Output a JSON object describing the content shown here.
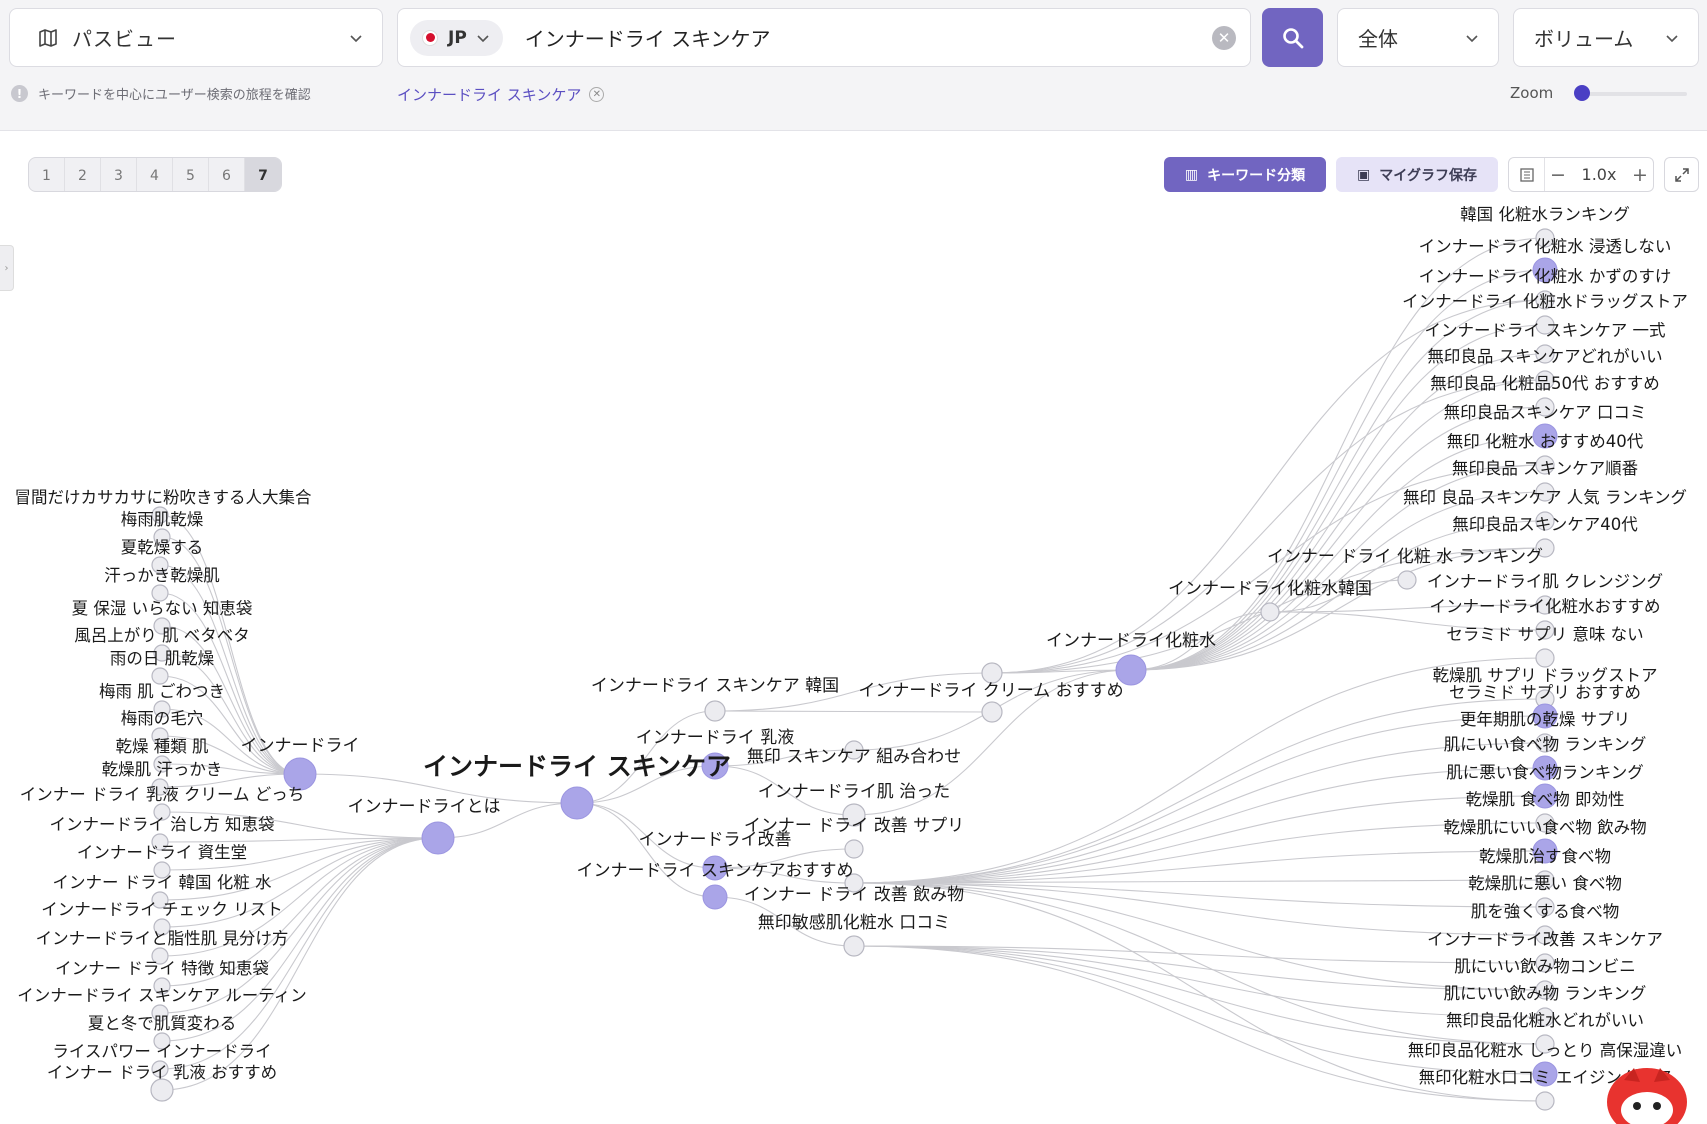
{
  "header": {
    "mode_label": "パスビュー",
    "country_code": "JP",
    "query": "インナードライ スキンケア",
    "scope_label": "全体",
    "sort_label": "ボリューム",
    "hint": "キーワードを中心にユーザー検索の旅程を確認",
    "active_tag": "インナードライ スキンケア",
    "zoom_label": "Zoom",
    "zoom_level": 0.02
  },
  "toolbar": {
    "depth_tabs": [
      "1",
      "2",
      "3",
      "4",
      "5",
      "6",
      "7"
    ],
    "selected_depth": "7",
    "classify_label": "キーワード分類",
    "save_label": "マイグラフ保存",
    "zoom_value": "1.0x",
    "minus": "−",
    "plus": "+"
  },
  "colors": {
    "accent": "#7165c1",
    "hub": "#aaa5e8",
    "leaf": "#ececf0",
    "edge": "#c9c9ce"
  },
  "graph": {
    "root": "インナードライ スキンケア",
    "left_hubs": [
      "インナードライ",
      "インナードライとは"
    ],
    "left_leaves": [
      "冒間だけカサカサに粉吹きする人大集合",
      "梅雨肌乾燥",
      "夏乾燥する",
      "汗っかき乾燥肌",
      "夏 保湿 いらない 知恵袋",
      "風呂上がり 肌 ベタベタ",
      "雨の日 肌乾燥",
      "梅雨 肌 ごわつき",
      "梅雨の毛穴",
      "乾燥 種類 肌",
      "乾燥肌 汗っかき",
      "インナー ドライ 乳液 クリーム どっち",
      "インナードライ 治し方 知恵袋",
      "インナードライ 資生堂",
      "インナー ドライ 韓国 化粧 水",
      "インナードライ チェック リスト",
      "インナードライと脂性肌 見分け方",
      "インナー ドライ 特徴 知恵袋",
      "インナードライ スキンケア ルーティン",
      "夏と冬で肌質変わる",
      "ライスパワー インナードライ",
      "インナー ドライ 乳液 おすすめ"
    ],
    "mid_keywords": [
      "インナードライ スキンケア 韓国",
      "インナードライ 乳液",
      "インナードライ改善",
      "インナードライ スキンケアおすすめ",
      "インナードライ クリーム おすすめ",
      "無印 スキンケア 組み合わせ",
      "インナードライ肌 治った",
      "インナー ドライ 改善 サプリ",
      "インナー ドライ 改善 飲み物",
      "無印敏感肌化粧水 口コミ",
      "インナードライ化粧水",
      "インナードライ化粧水韓国",
      "インナー ドライ 化粧 水 ランキング"
    ],
    "right_leaves": [
      "韓国 化粧水ランキング",
      "インナードライ化粧水 浸透しない",
      "インナードライ化粧水 かずのすけ",
      "インナードライ 化粧水ドラッグストア",
      "インナードライ スキンケア 一式",
      "無印良品 スキンケアどれがいい",
      "無印良品 化粧品50代 おすすめ",
      "無印良品スキンケア 口コミ",
      "無印 化粧水 おすすめ40代",
      "無印良品 スキンケア順番",
      "無印 良品 スキンケア 人気 ランキング",
      "無印良品スキンケア40代",
      "インナードライ肌 クレンジング",
      "インナードライ化粧水おすすめ",
      "セラミド サプリ 意味 ない",
      "乾燥肌 サプリ ドラッグストア",
      "セラミド サプリ おすすめ",
      "更年期肌の乾燥 サプリ",
      "肌にいい食べ物 ランキング",
      "肌に悪い食べ物ランキング",
      "乾燥肌 食べ物 即効性",
      "乾燥肌にいい食べ物 飲み物",
      "乾燥肌治す食べ物",
      "乾燥肌に悪い 食べ物",
      "肌を強くする食べ物",
      "インナードライ改善 スキンケア",
      "肌にいい飲み物コンビニ",
      "肌にいい飲み物 ランキング",
      "無印良品化粧水どれがいい",
      "無印良品化粧水 しっとり 高保湿違い",
      "無印化粧水口コミ エイジングケア"
    ]
  }
}
